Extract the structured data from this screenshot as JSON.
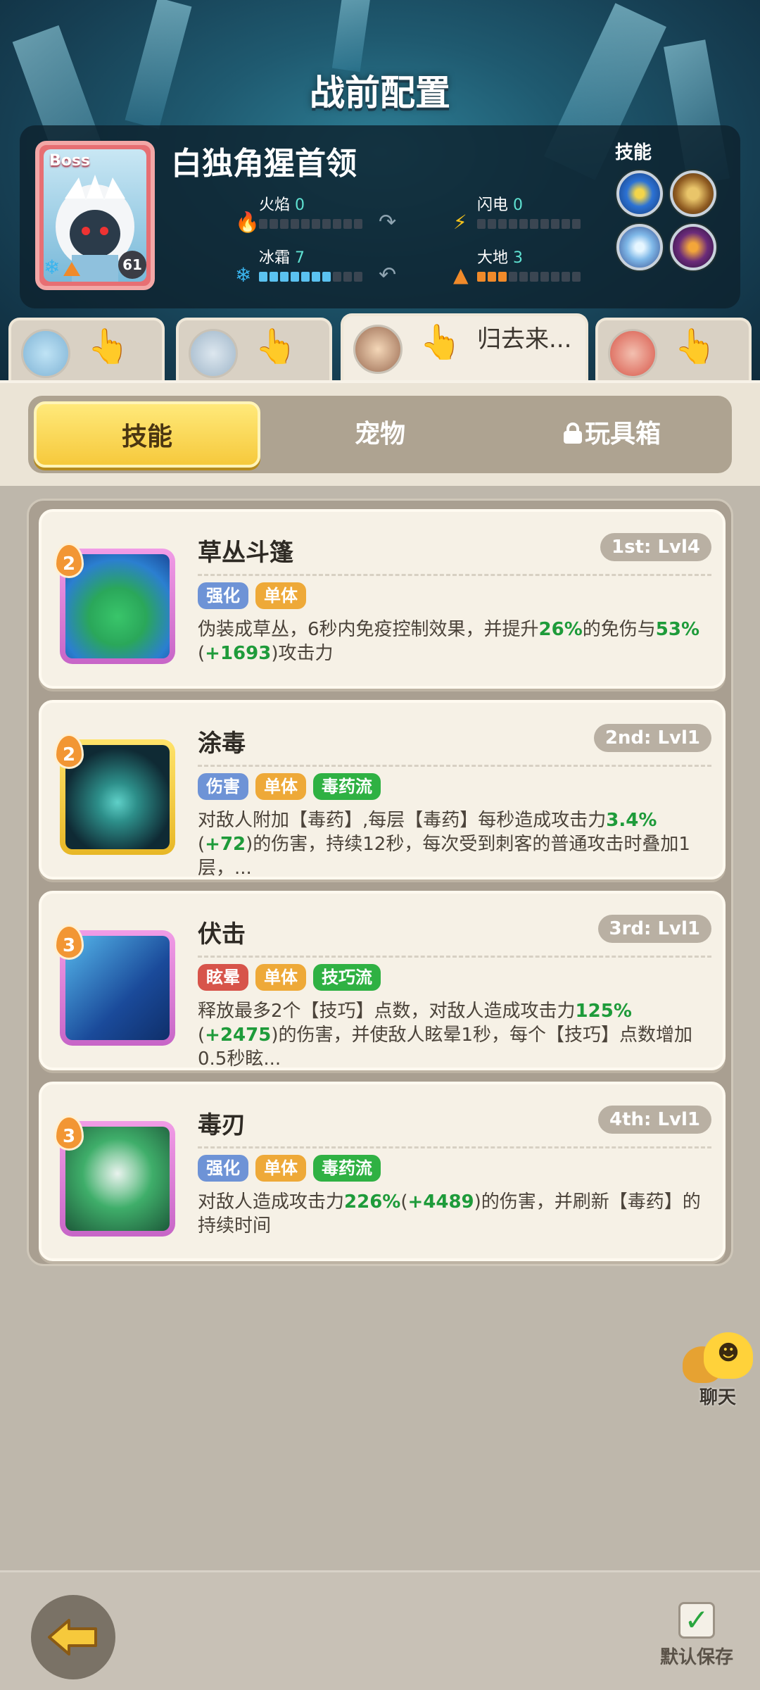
{
  "title": "战前配置",
  "boss": {
    "tag": "Boss",
    "name": "白独角猩首领",
    "level": "61",
    "elements": [
      {
        "label": "火焰",
        "value": "0",
        "filled": 0,
        "icon": "fire-icon"
      },
      {
        "label": "闪电",
        "value": "0",
        "filled": 0,
        "icon": "lightning-icon"
      },
      {
        "label": "冰霜",
        "value": "7",
        "filled": 7,
        "icon": "snowflake-icon"
      },
      {
        "label": "大地",
        "value": "3",
        "filled": 3,
        "icon": "earth-icon"
      }
    ],
    "skills_label": "技能",
    "skill_icons": [
      "star-skill-icon",
      "beast-skill-icon",
      "ice-crystal-skill-icon",
      "dark-orb-skill-icon"
    ]
  },
  "heroes": [
    {
      "name": ""
    },
    {
      "name": ""
    },
    {
      "name": "归去来..."
    },
    {
      "name": ""
    }
  ],
  "segment": {
    "tabs": [
      {
        "label": "技能"
      },
      {
        "label": "宠物"
      },
      {
        "label": "玩具箱",
        "locked": true
      }
    ]
  },
  "skills": [
    {
      "rank": "2",
      "name": "草丛斗篷",
      "level": "1st: Lvl4",
      "tags": [
        "强化",
        "单体"
      ],
      "desc": "伪装成草丛，6秒内免疫控制效果，并提升26%的免伤与53%(+1693)攻击力",
      "icon_colors": [
        "#2b7fd0",
        "#39c56a"
      ]
    },
    {
      "rank": "2",
      "name": "涂毒",
      "level": "2nd: Lvl1",
      "tags": [
        "伤害",
        "单体",
        "毒药流"
      ],
      "desc": "对敌人附加【毒药】,每层【毒药】每秒造成攻击力3.4%(+72)的伤害，持续12秒，每次受到刺客的普通攻击时叠加1层，...",
      "icon_colors": [
        "#0f2a34",
        "#2d8f8a"
      ]
    },
    {
      "rank": "3",
      "name": "伏击",
      "level": "3rd: Lvl1",
      "tags": [
        "眩晕",
        "单体",
        "技巧流"
      ],
      "desc": "释放最多2个【技巧】点数，对敌人造成攻击力125%(+2475)的伤害，并使敌人眩晕1秒，每个【技巧】点数增加0.5秒眩...",
      "icon_colors": [
        "#1a4a9a",
        "#56b8ec"
      ]
    },
    {
      "rank": "3",
      "name": "毒刃",
      "level": "4th: Lvl1",
      "tags": [
        "强化",
        "单体",
        "毒药流"
      ],
      "desc": "对敌人造成攻击力226%(+4489)的伤害，并刷新【毒药】的持续时间",
      "icon_colors": [
        "#1d5a3a",
        "#3fae6a"
      ]
    }
  ],
  "chat_label": "聊天",
  "save_label": "默认保存",
  "colors": {
    "accent_yellow": "#f6c93c",
    "highlight_green": "#1e9b3a",
    "boss_red": "#e76f73"
  }
}
